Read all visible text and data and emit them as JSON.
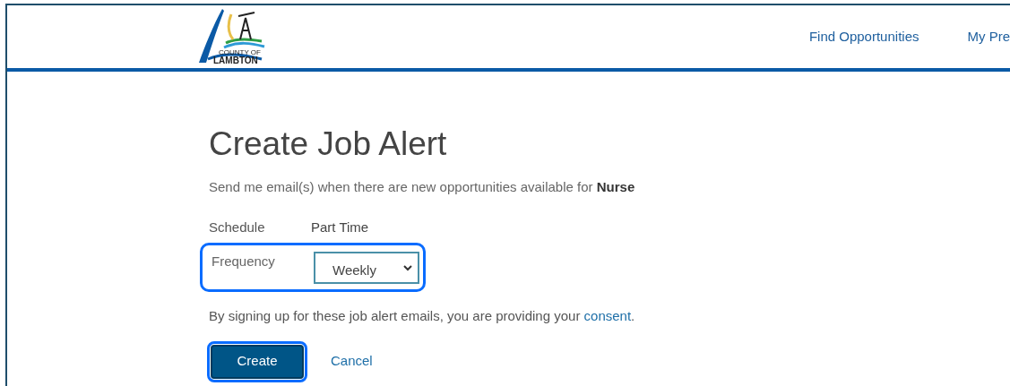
{
  "header": {
    "logo": {
      "line_1": "COUNTY OF",
      "line_2": "LAMBTON"
    },
    "nav": [
      {
        "label": "Find Opportunities"
      },
      {
        "label": "My Pre"
      }
    ]
  },
  "form": {
    "title": "Create Job Alert",
    "intro": "Send me email(s) when there are new opportunities available for **Nurse**",
    "schedule": {
      "label": "Schedule",
      "value": "Part Time"
    },
    "frequency": {
      "label": "Frequency",
      "value": "Weekly",
      "focused": true
    },
    "consent": {
      "before": "By signing up for these job alert emails, you are providing your ",
      "link": "consent",
      "after": "."
    },
    "buttons": [
      {
        "label": "Create",
        "kind": "primary",
        "focused": true
      },
      {
        "label": "Cancel",
        "kind": "link",
        "focused": false
      }
    ]
  }
}
